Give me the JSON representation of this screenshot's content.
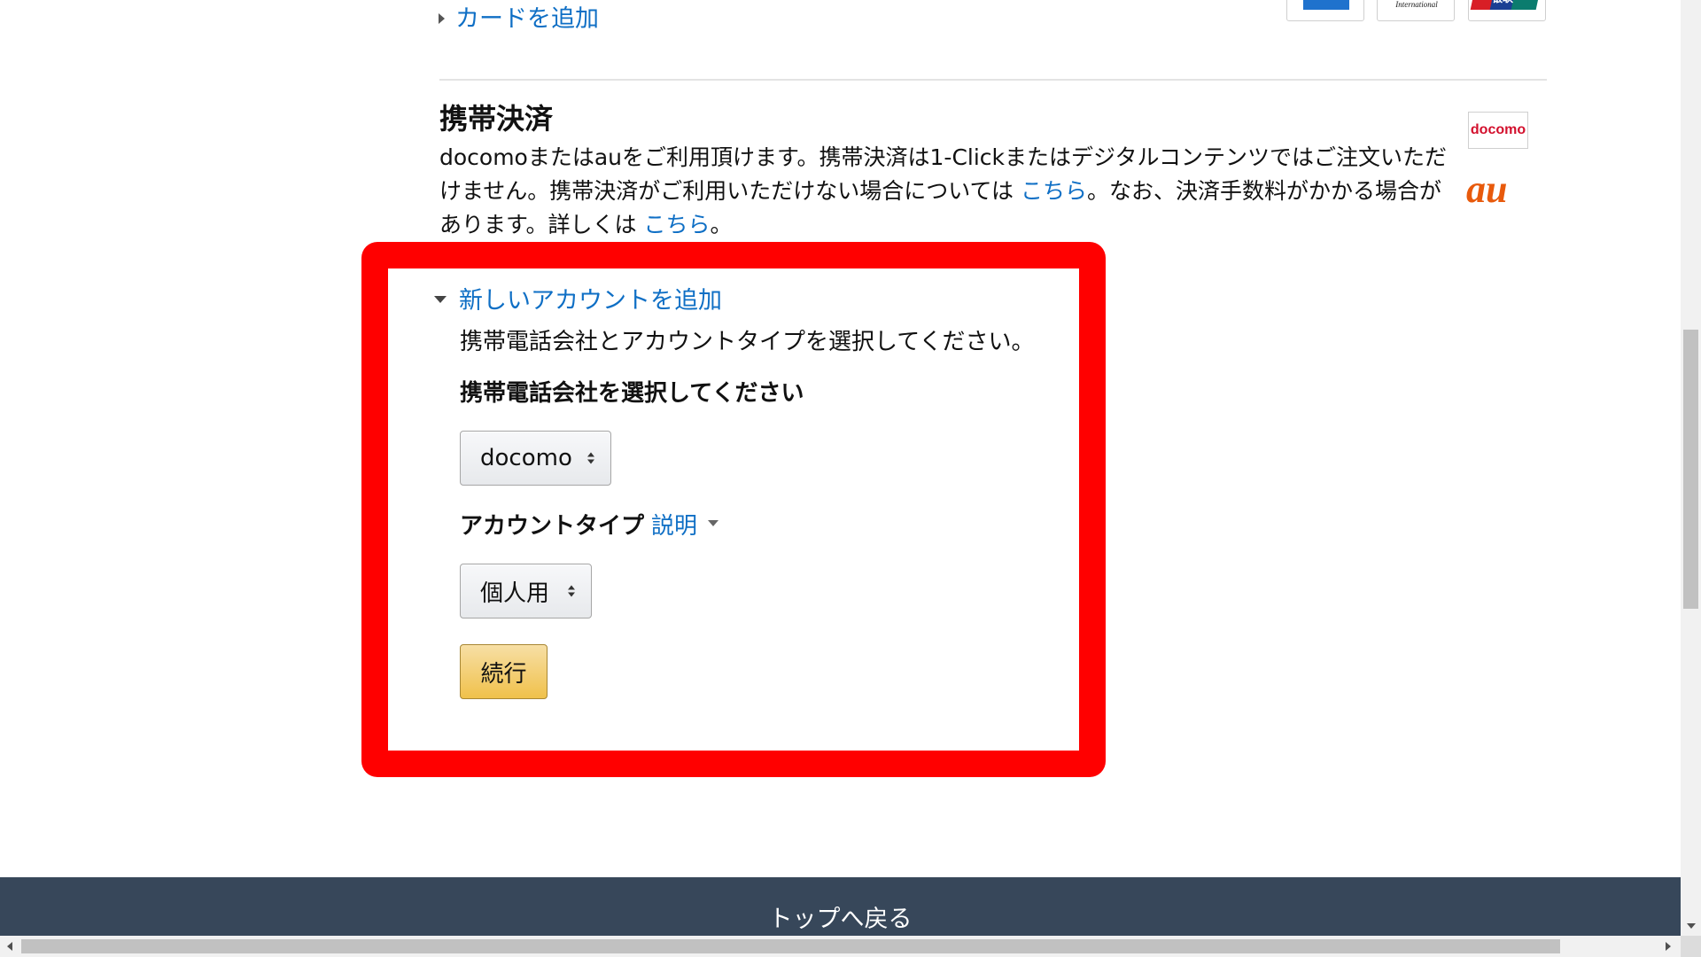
{
  "add_card": {
    "label": "カードを追加"
  },
  "card_logos": [
    {
      "name": "american-express-logo",
      "text": "",
      "color": "#1f72cd"
    },
    {
      "name": "diners-club-logo",
      "text": "Diners Club International",
      "color": "#1a1a1a"
    },
    {
      "name": "unionpay-logo",
      "text": "银联",
      "color": "#d81e26"
    }
  ],
  "carrier_billing": {
    "title": "携帯決済",
    "desc_part1": "docomoまたはauをご利用頂けます。携帯決済は1-Clickまたはデジタルコンテンツではご注文いただけません。携帯決済がご利用いただけない場合については ",
    "link1": "こちら",
    "desc_part2": "。なお、決済手数料がかかる場合があります。詳しくは ",
    "link2": "こちら",
    "desc_part3": "。",
    "docomo_logo_text": "docomo",
    "au_logo_text": "au"
  },
  "new_account": {
    "toggle_label": "新しいアカウントを追加",
    "instruction": "携帯電話会社とアカウントタイプを選択してください。",
    "carrier_label": "携帯電話会社を選択してください",
    "carrier_selected": "docomo",
    "account_type_label": "アカウントタイプ",
    "explain_link": "説明",
    "account_type_selected": "個人用",
    "continue_button": "続行"
  },
  "footer": {
    "back_to_top": "トップへ戻る"
  },
  "colors": {
    "link": "#0f6fc5",
    "highlight": "#ff0000",
    "footer_bg": "#37475a",
    "button_yellow": "#f0c14b"
  }
}
